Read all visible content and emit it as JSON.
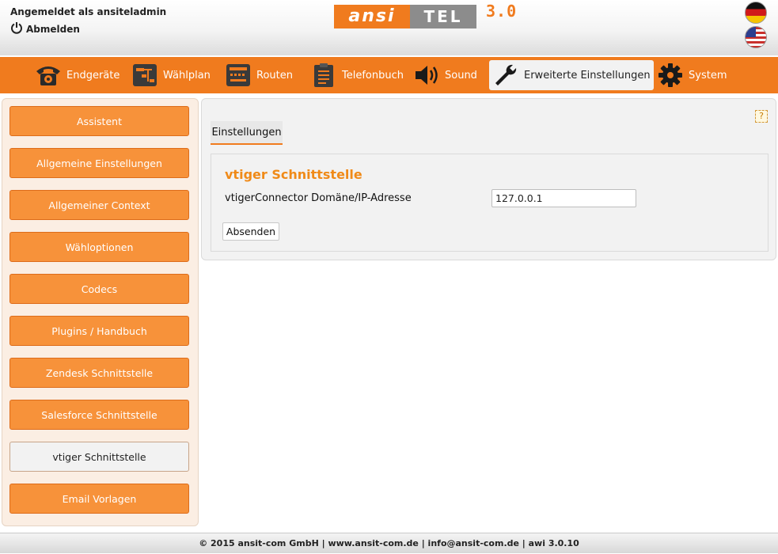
{
  "header": {
    "logged_in_text": "Angemeldet als ansiteladmin",
    "logout_label": "Abmelden",
    "logo": {
      "part1": "ansi",
      "part2": "TEL",
      "version": "3.0"
    },
    "languages": [
      "Deutsch",
      "English"
    ]
  },
  "nav": {
    "items": [
      {
        "label": "Endgeräte",
        "icon": "phone-icon"
      },
      {
        "label": "Wählplan",
        "icon": "dialplan-icon"
      },
      {
        "label": "Routen",
        "icon": "routes-icon"
      },
      {
        "label": "Telefonbuch",
        "icon": "phonebook-icon"
      },
      {
        "label": "Sound",
        "icon": "speaker-icon"
      },
      {
        "label": "Erweiterte Einstellungen",
        "icon": "wrench-icon",
        "active": true
      },
      {
        "label": "System",
        "icon": "gear-icon"
      }
    ]
  },
  "sidebar": {
    "items": [
      {
        "label": "Assistent"
      },
      {
        "label": "Allgemeine Einstellungen"
      },
      {
        "label": "Allgemeiner Context"
      },
      {
        "label": "Wähloptionen"
      },
      {
        "label": "Codecs"
      },
      {
        "label": "Plugins / Handbuch"
      },
      {
        "label": "Zendesk Schnittstelle"
      },
      {
        "label": "Salesforce Schnittstelle"
      },
      {
        "label": "vtiger Schnittstelle",
        "active": true
      },
      {
        "label": "Email Vorlagen"
      }
    ]
  },
  "main": {
    "help_label": "?",
    "tab_label": "Einstellungen",
    "section_title": "vtiger Schnittstelle",
    "field_label": "vtigerConnector Domäne/IP-Adresse",
    "field_value": "127.0.0.1",
    "submit_label": "Absenden"
  },
  "footer": {
    "text": "© 2015 ansit-com GmbH | www.ansit-com.de | info@ansit-com.de | awi 3.0.10"
  },
  "colors": {
    "accent": "#f07b1e",
    "sidebar_button": "#f7923a",
    "title": "#f08a18"
  }
}
